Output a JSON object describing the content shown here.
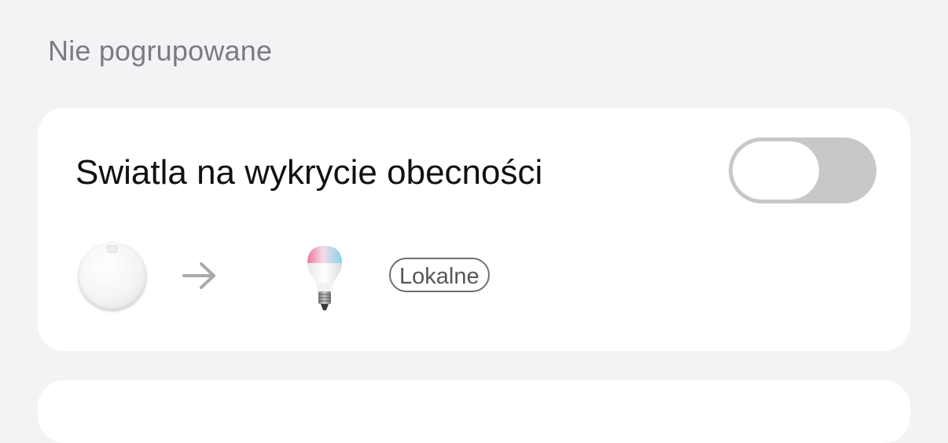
{
  "section": {
    "label": "Nie pogrupowane"
  },
  "automation": {
    "title": "Swiatla na wykrycie obecności",
    "enabled": false,
    "trigger_device_icon": "presence-sensor-icon",
    "action_device_icon": "smart-bulb-icon",
    "badge": "Lokalne"
  },
  "colors": {
    "background": "#f2f3f5",
    "card": "#ffffff",
    "toggle_off": "#c8c8c8",
    "section_label": "#7a7c80"
  }
}
